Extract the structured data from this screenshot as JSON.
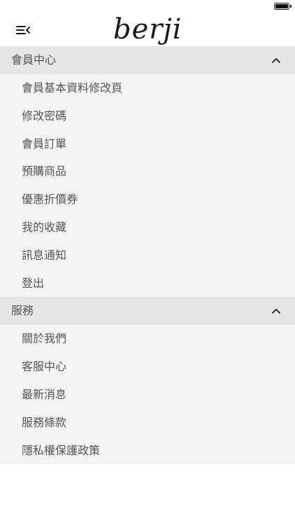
{
  "header": {
    "logo_text": "berji"
  },
  "sections": [
    {
      "title": "會員中心",
      "items": [
        "會員基本資料修改頁",
        "修改密碼",
        "會員訂單",
        "預購商品",
        "優惠折價券",
        "我的收藏",
        "訊息通知",
        "登出"
      ]
    },
    {
      "title": "服務",
      "items": [
        "關於我們",
        "客服中心",
        "最新消息",
        "服務條款",
        "隱私權保護政策"
      ]
    }
  ],
  "icons": {
    "menu": "menu-collapse-icon",
    "section_toggle": "chevron-up-icon",
    "battery": "battery-icon"
  },
  "colors": {
    "section_header_bg": "#e6e6e6",
    "item_bg": "#f4f4f4",
    "text": "#555555"
  }
}
